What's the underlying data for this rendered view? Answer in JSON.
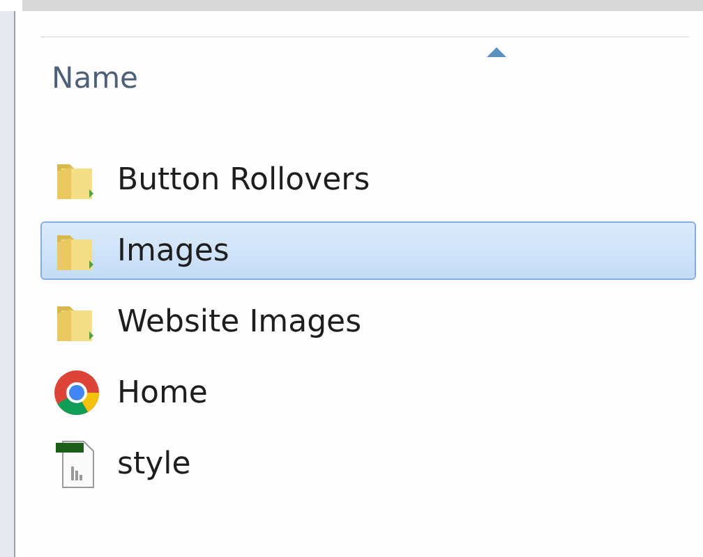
{
  "column_header": {
    "label": "Name",
    "sort_ascending": true
  },
  "items": [
    {
      "name": "Button Rollovers",
      "kind": "folder",
      "selected": false
    },
    {
      "name": "Images",
      "kind": "folder",
      "selected": true
    },
    {
      "name": "Website Images",
      "kind": "folder",
      "selected": false
    },
    {
      "name": "Home",
      "kind": "browser",
      "selected": false
    },
    {
      "name": "style",
      "kind": "stylesheet",
      "selected": false
    }
  ]
}
